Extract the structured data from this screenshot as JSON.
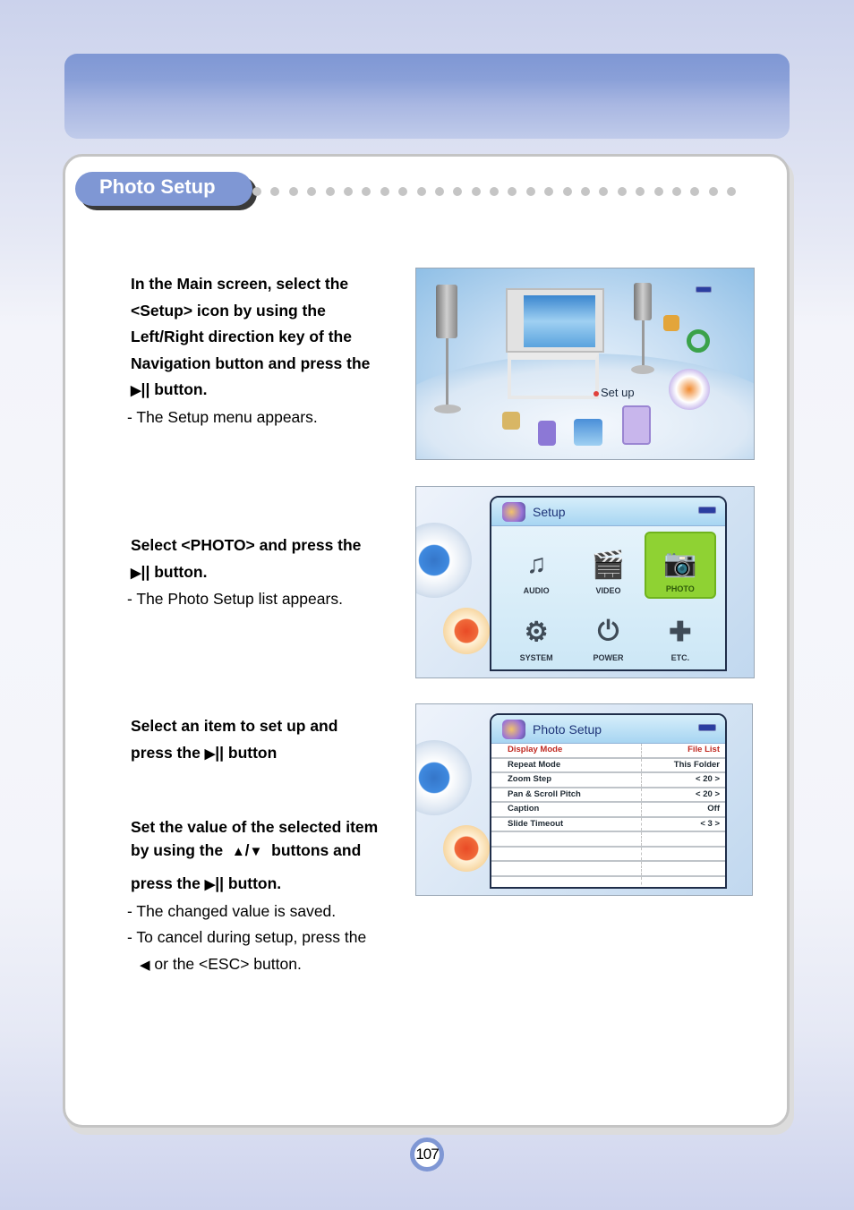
{
  "section_title": "Photo Setup",
  "steps": [
    {
      "instruction_lines": [
        "In the Main screen, select the",
        "<Setup> icon by using the",
        "Left/Right direction key of the",
        "Navigation button and press the"
      ],
      "button_line": "|| button.",
      "note": "- The Setup menu appears."
    },
    {
      "instruction_lines": [
        "Select <PHOTO> and press the"
      ],
      "button_line": "|| button.",
      "note": "- The Photo Setup list appears."
    },
    {
      "instruction_lines": [
        "Select an item to set up and"
      ],
      "button_prefix": "press the ",
      "button_line": "|| button"
    },
    {
      "instruction_lines": [
        "Set the value of the selected item"
      ],
      "updown_prefix": "by using the ",
      "updown_suffix": " buttons and",
      "button_prefix": "press the ",
      "button_line": "|| button.",
      "notes": [
        "- The changed value is saved.",
        "- To cancel during setup, press the",
        " or the <ESC> button."
      ]
    }
  ],
  "glyphs": {
    "play_pause": "▶",
    "up": "▲",
    "down": "▼",
    "slash": "/",
    "left": "◀"
  },
  "screen_main": {
    "setup_label": "Set up"
  },
  "screen_setup": {
    "title": "Setup",
    "items": [
      {
        "label": "AUDIO",
        "icon": "music-note-icon"
      },
      {
        "label": "VIDEO",
        "icon": "clapperboard-icon"
      },
      {
        "label": "PHOTO",
        "icon": "photo-camera-icon",
        "selected": true
      },
      {
        "label": "SYSTEM",
        "icon": "gear-icon"
      },
      {
        "label": "POWER",
        "icon": "power-icon"
      },
      {
        "label": "ETC.",
        "icon": "puzzle-icon"
      }
    ]
  },
  "screen_photo_setup": {
    "title": "Photo Setup",
    "rows": [
      {
        "key": "Display Mode",
        "value": "File List",
        "active": true
      },
      {
        "key": "Repeat Mode",
        "value": "This Folder"
      },
      {
        "key": "Zoom Step",
        "value": "< 20 >"
      },
      {
        "key": "Pan & Scroll Pitch",
        "value": "< 20 >"
      },
      {
        "key": "Caption",
        "value": "Off"
      },
      {
        "key": "Slide Timeout",
        "value": "< 3 >"
      },
      {
        "key": "",
        "value": ""
      },
      {
        "key": "",
        "value": ""
      },
      {
        "key": "",
        "value": ""
      },
      {
        "key": "",
        "value": ""
      }
    ]
  },
  "page_number": "107",
  "colors": {
    "accent": "#7f97d4",
    "highlight_red": "#c02a22",
    "selected_green": "#8fd233"
  }
}
